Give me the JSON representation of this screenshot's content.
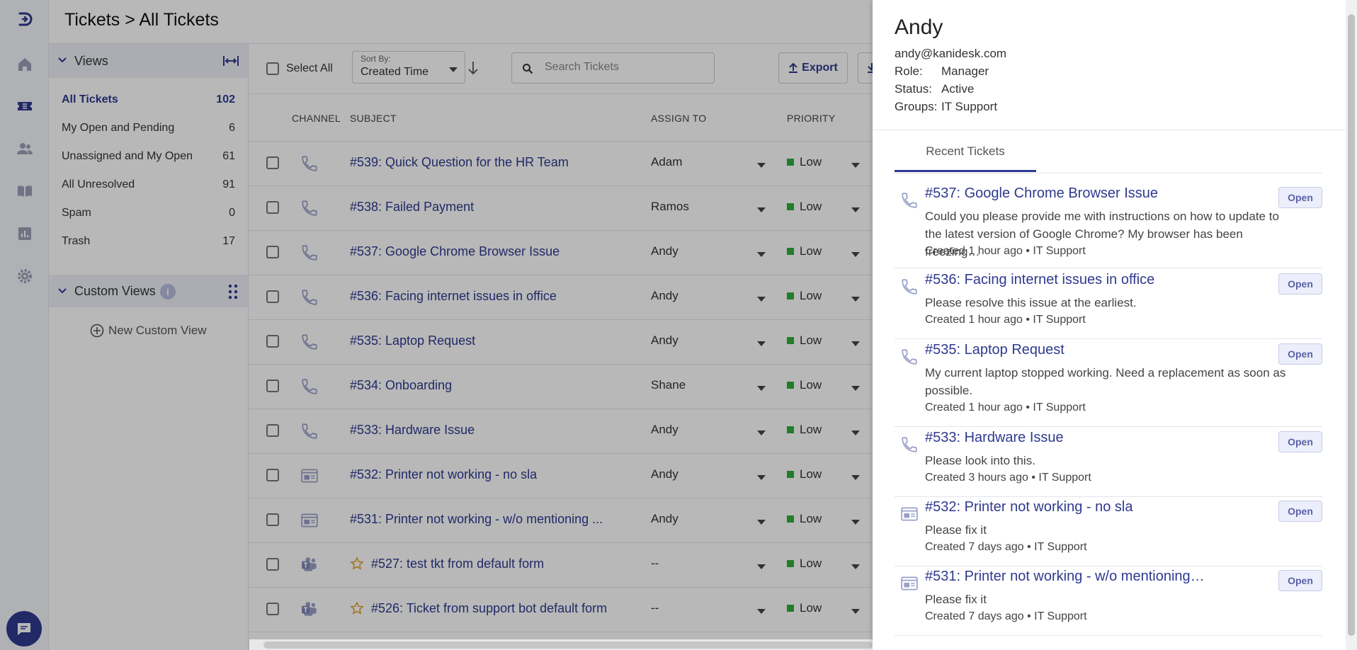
{
  "header": {
    "title": "Tickets > All Tickets"
  },
  "views": {
    "title": "Views",
    "items": [
      {
        "label": "All Tickets",
        "count": "102"
      },
      {
        "label": "My Open and Pending",
        "count": "6"
      },
      {
        "label": "Unassigned and My Open",
        "count": "61"
      },
      {
        "label": "All Unresolved",
        "count": "91"
      },
      {
        "label": "Spam",
        "count": "0"
      },
      {
        "label": "Trash",
        "count": "17"
      }
    ],
    "custom_views_title": "Custom Views",
    "new_custom_view": "New Custom View"
  },
  "toolbar": {
    "select_all": "Select All",
    "sort_label": "Sort By:",
    "sort_value": "Created Time",
    "search_placeholder": "Search Tickets",
    "export_label": "Export"
  },
  "table": {
    "columns": {
      "channel": "CHANNEL",
      "subject": "SUBJECT",
      "assign": "ASSIGN TO",
      "priority": "PRIORITY"
    },
    "rows": [
      {
        "channel": "phone-icon",
        "starred": false,
        "subject": "#539: Quick Question for the HR Team",
        "assign": "Adam",
        "priority": "Low"
      },
      {
        "channel": "phone-icon",
        "starred": false,
        "subject": "#538: Failed Payment",
        "assign": "Ramos",
        "priority": "Low"
      },
      {
        "channel": "phone-icon",
        "starred": false,
        "subject": "#537: Google Chrome Browser Issue",
        "assign": "Andy",
        "priority": "Low"
      },
      {
        "channel": "phone-icon",
        "starred": false,
        "subject": "#536: Facing internet issues in office",
        "assign": "Andy",
        "priority": "Low"
      },
      {
        "channel": "phone-icon",
        "starred": false,
        "subject": "#535: Laptop Request",
        "assign": "Andy",
        "priority": "Low"
      },
      {
        "channel": "phone-icon",
        "starred": false,
        "subject": "#534: Onboarding",
        "assign": "Shane",
        "priority": "Low"
      },
      {
        "channel": "phone-icon",
        "starred": false,
        "subject": "#533: Hardware Issue",
        "assign": "Andy",
        "priority": "Low"
      },
      {
        "channel": "webform-icon",
        "starred": false,
        "subject": "#532: Printer not working - no sla",
        "assign": "Andy",
        "priority": "Low"
      },
      {
        "channel": "webform-icon",
        "starred": false,
        "subject": "#531: Printer not working - w/o mentioning ...",
        "assign": "Andy",
        "priority": "Low"
      },
      {
        "channel": "teams-icon",
        "starred": true,
        "subject": "#527: test tkt from default form",
        "assign": "--",
        "priority": "Low"
      },
      {
        "channel": "teams-icon",
        "starred": true,
        "subject": "#526: Ticket from support bot default form",
        "assign": "--",
        "priority": "Low"
      }
    ]
  },
  "panel": {
    "name": "Andy",
    "email": "andy@kanidesk.com",
    "role_key": "Role:",
    "role": "Manager",
    "status_key": "Status:",
    "status": "Active",
    "groups_key": "Groups:",
    "groups": "IT Support",
    "tab": "Recent Tickets",
    "tickets": [
      {
        "icon": "phone-icon",
        "title": "#537: Google Chrome Browser Issue",
        "desc": "Could you please provide me with instructions on how to update to the latest version of Google Chrome? My browser has been freezing…",
        "meta": "Created 1 hour ago • IT Support",
        "status": "Open"
      },
      {
        "icon": "phone-icon",
        "title": "#536: Facing internet issues in office",
        "desc": "Please resolve this issue at the earliest.",
        "meta": "Created 1 hour ago • IT Support",
        "status": "Open"
      },
      {
        "icon": "phone-icon",
        "title": "#535: Laptop Request",
        "desc": "My current laptop stopped working. Need a replacement as soon as possible.",
        "meta": "Created 1 hour ago • IT Support",
        "status": "Open"
      },
      {
        "icon": "phone-icon",
        "title": "#533: Hardware Issue",
        "desc": "Please look into this.",
        "meta": "Created 3 hours ago • IT Support",
        "status": "Open"
      },
      {
        "icon": "webform-icon",
        "title": "#532: Printer not working - no sla",
        "desc": "Please fix it",
        "meta": "Created 7 days ago • IT Support",
        "status": "Open"
      },
      {
        "icon": "webform-icon",
        "title": "#531: Printer not working - w/o mentioning…",
        "desc": "Please fix it",
        "meta": "Created 7 days ago • IT Support",
        "status": "Open"
      }
    ]
  },
  "colors": {
    "accent": "#2f3a8f",
    "priority_low": "#2fae3b",
    "star": "#e0a030"
  }
}
